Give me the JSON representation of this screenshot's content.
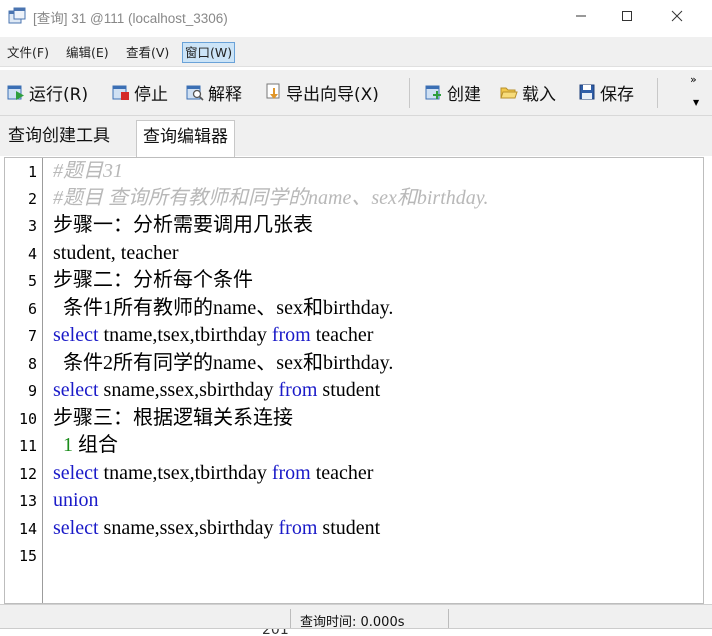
{
  "window": {
    "title": "[查询] 31 @111 (localhost_3306)",
    "minimize_icon": "minimize-icon",
    "maximize_icon": "maximize-icon",
    "close_icon": "close-icon"
  },
  "menu": {
    "items": [
      {
        "label": "文件(F)"
      },
      {
        "label": "编辑(E)"
      },
      {
        "label": "查看(V)"
      },
      {
        "label": "窗口(W)"
      }
    ]
  },
  "toolbar": {
    "run": "运行(R)",
    "stop": "停止",
    "explain": "解释",
    "export": "导出向导(X)",
    "create": "创建",
    "load": "载入",
    "save": "保存",
    "overflow": "»"
  },
  "tabs": [
    {
      "label": "查询创建工具"
    },
    {
      "label": "查询编辑器"
    }
  ],
  "editor": {
    "line_numbers": [
      "1",
      "2",
      "3",
      "4",
      "5",
      "6",
      "7",
      "8",
      "9",
      "10",
      "11",
      "12",
      "13",
      "14",
      "15"
    ],
    "lines": [
      {
        "text": "#题目31"
      },
      {
        "text": "#题目 查询所有教师和同学的name、sex和birthday."
      },
      {
        "text": "步骤一：分析需要调用几张表"
      },
      {
        "text": "student, teacher"
      },
      {
        "text": "步骤二：分析每个条件"
      },
      {
        "text": "  条件1所有教师的name、sex和birthday."
      },
      {
        "kw1": "select",
        "mid": " tname,tsex,tbirthday ",
        "kw2": "from",
        "tail": " teacher"
      },
      {
        "text": "  条件2所有同学的name、sex和birthday."
      },
      {
        "kw1": "select",
        "mid": " sname,ssex,sbirthday ",
        "kw2": "from",
        "tail": " student"
      },
      {
        "text": "步骤三：根据逻辑关系连接"
      },
      {
        "num": "1",
        "tail": " 组合"
      },
      {
        "kw1": "select",
        "mid": " tname,tsex,tbirthday ",
        "kw2": "from",
        "tail": " teacher"
      },
      {
        "kw1": "union"
      },
      {
        "kw1": "select",
        "mid": " sname,ssex,sbirthday ",
        "kw2": "from",
        "tail": " student"
      },
      {
        "text": ""
      }
    ]
  },
  "status": {
    "query_time": "查询时间: 0.000s"
  },
  "background_peek": "201",
  "colors": {
    "keyword": "#1a1ac8",
    "comment": "#b8b8b8",
    "number": "#1a8c1a"
  }
}
